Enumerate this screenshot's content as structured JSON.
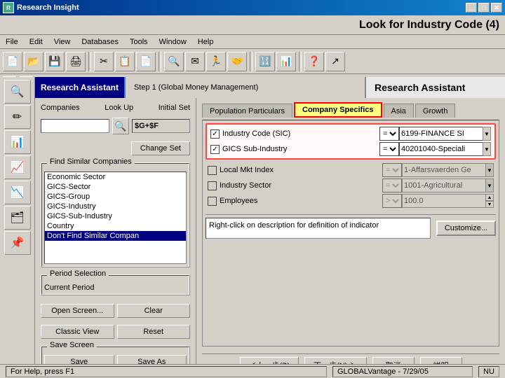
{
  "window": {
    "title": "Research Insight",
    "page_title": "Look for Industry Code (4)"
  },
  "menu": {
    "items": [
      "File",
      "Edit",
      "View",
      "Databases",
      "Tools",
      "Window",
      "Help"
    ]
  },
  "toolbar": {
    "buttons": [
      "📄",
      "📂",
      "💾",
      "🖨",
      "✂",
      "📋",
      "📄",
      "📋",
      "🔍",
      "✉",
      "🏃",
      "🤝",
      "🔢",
      "📊",
      "❓",
      "↗"
    ]
  },
  "ra_header": {
    "badge": "Research Assistant",
    "step": "Step 1  (Global Money Management)",
    "title": "Research Assistant"
  },
  "left_panel": {
    "companies_label": "Companies",
    "look_up_label": "Look Up",
    "initial_set_label": "Initial Set",
    "initial_set_value": "$G+$F",
    "change_set_label": "Change Set",
    "find_similar_label": "Find Similar Companies",
    "list_items": [
      "Economic Sector",
      "GICS-Sector",
      "GICS-Group",
      "GICS-Industry",
      "GICS-Sub-Industry",
      "Country"
    ],
    "dont_find_label": "Don't Find Similar Compan",
    "period_label": "Period Selection",
    "current_period_label": "Current Period",
    "open_screen_label": "Open Screen...",
    "clear_label": "Clear",
    "classic_view_label": "Classic View",
    "reset_label": "Reset",
    "save_screen_label": "Save Screen",
    "save_label": "Save",
    "save_as_label": "Save As"
  },
  "right_panel": {
    "tabs": [
      "Population Particulars",
      "Company Specifics",
      "Asia",
      "Growth"
    ],
    "active_tab": "Company Specifics",
    "rows": [
      {
        "checked": true,
        "label": "Industry Code (SIC)",
        "operator": "=",
        "value": "6199-FINANCE SI",
        "highlighted": true
      },
      {
        "checked": true,
        "label": "GICS Sub-Industry",
        "operator": "=",
        "value": "40201040-Speciali",
        "highlighted": true
      },
      {
        "checked": false,
        "label": "Local Mkt Index",
        "operator": "=",
        "value": "1-Affarsvaerden Ge",
        "highlighted": false
      },
      {
        "checked": false,
        "label": "Industry Sector",
        "operator": "=",
        "value": "1001-Agricultural",
        "highlighted": false
      },
      {
        "checked": false,
        "label": "Employees",
        "operator": ">",
        "value": "100.0",
        "highlighted": false
      }
    ],
    "description_label": "Right-click on description for definition of indicator",
    "customize_label": "Customize..."
  },
  "bottom_nav": {
    "back_label": "＜上一步(B)",
    "next_label": "下一步(N) ＞",
    "cancel_label": "取消",
    "help_label": "説明"
  },
  "status_bar": {
    "help_text": "For Help, press F1",
    "version_text": "GLOBALVantage - 7/29/05",
    "indicator": "NU"
  },
  "sidebar_icons": [
    "🔍",
    "✏",
    "📊",
    "📈",
    "📉",
    "🗂",
    "📌"
  ]
}
